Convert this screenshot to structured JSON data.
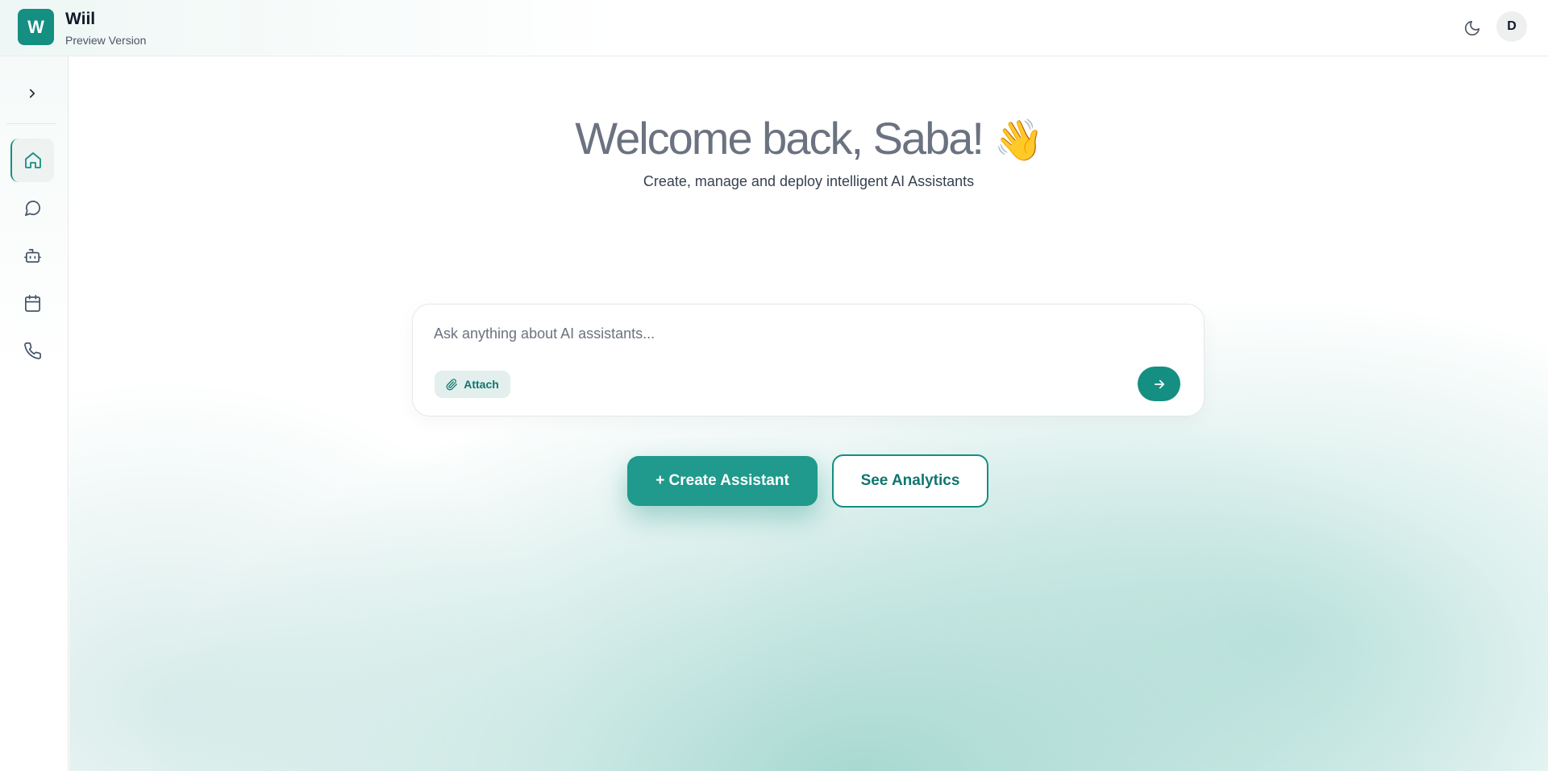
{
  "header": {
    "logo_letter": "W",
    "app_name": "Wiil",
    "app_subtitle": "Preview Version",
    "theme_icon": "moon-icon",
    "avatar_initial": "D"
  },
  "sidebar": {
    "toggle_icon": "chevron-right-icon",
    "items": [
      {
        "name": "home",
        "icon": "home-icon",
        "active": true
      },
      {
        "name": "chat",
        "icon": "message-circle-icon",
        "active": false
      },
      {
        "name": "assistants",
        "icon": "bot-icon",
        "active": false
      },
      {
        "name": "calendar",
        "icon": "calendar-icon",
        "active": false
      },
      {
        "name": "calls",
        "icon": "phone-icon",
        "active": false
      }
    ]
  },
  "main": {
    "welcome": "Welcome back, Saba!",
    "welcome_emoji": "👋",
    "subtitle": "Create, manage and deploy intelligent AI Assistants",
    "ask": {
      "placeholder": "Ask anything about AI assistants...",
      "value": "",
      "attach_label": "Attach",
      "send_icon": "arrow-right-icon"
    },
    "create_button": "+ Create Assistant",
    "analytics_button": "See Analytics"
  },
  "colors": {
    "primary": "#148f82",
    "primary_light": "#1f9a8c",
    "text_muted": "#6b7280"
  }
}
